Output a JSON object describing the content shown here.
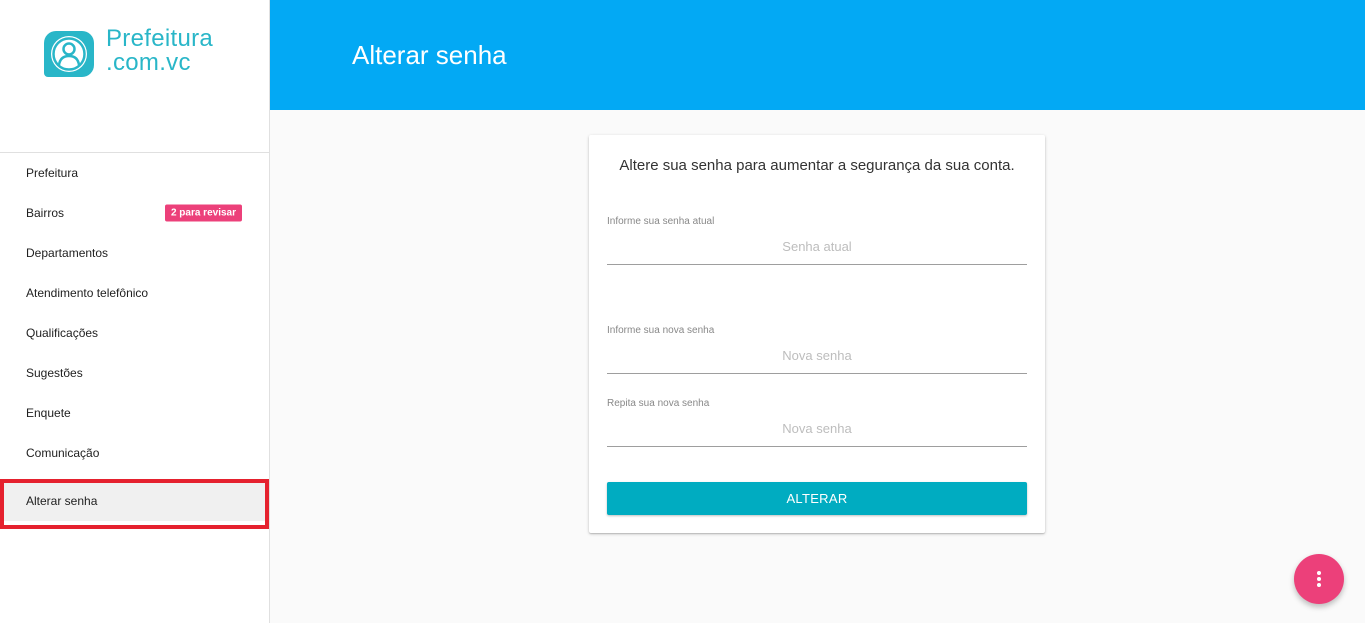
{
  "logo": {
    "line1": "Prefeitura",
    "line2": ".com.vc",
    "icon": "user-chat-bubble-icon",
    "color": "#29b6c8"
  },
  "sidebar": {
    "items": [
      {
        "label": "Prefeitura"
      },
      {
        "label": "Bairros",
        "badge": "2 para revisar"
      },
      {
        "label": "Departamentos"
      },
      {
        "label": "Atendimento telefônico"
      },
      {
        "label": "Qualificações"
      },
      {
        "label": "Sugestões"
      },
      {
        "label": "Enquete"
      },
      {
        "label": "Comunicação"
      },
      {
        "label": "Alterar senha",
        "active": true
      }
    ]
  },
  "header": {
    "title": "Alterar senha",
    "color": "#03a9f4"
  },
  "form": {
    "intro": "Altere sua senha para aumentar a segurança da sua conta.",
    "current_password": {
      "label": "Informe sua senha atual",
      "placeholder": "Senha atual"
    },
    "new_password": {
      "label": "Informe sua nova senha",
      "placeholder": "Nova senha"
    },
    "confirm_password": {
      "label": "Repita sua nova senha",
      "placeholder": "Nova senha"
    },
    "submit_label": "ALTERAR"
  },
  "fab": {
    "icon": "more-vertical-icon",
    "color": "#ec407a"
  },
  "colors": {
    "accent": "#00acc1",
    "badge": "#ec407a",
    "highlight": "#e5212e"
  }
}
